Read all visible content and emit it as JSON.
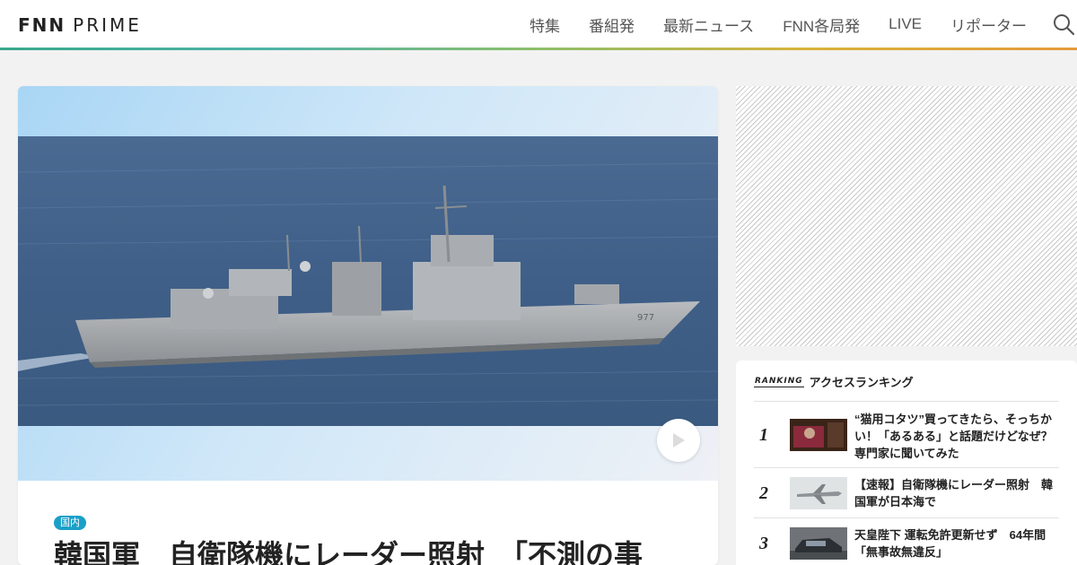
{
  "header": {
    "logo_fnn": "FNN",
    "logo_prime": "PRIME",
    "nav": [
      {
        "label": "特集"
      },
      {
        "label": "番組発"
      },
      {
        "label": "最新ニュース"
      },
      {
        "label": "FNN各局発"
      },
      {
        "label": "LIVE"
      },
      {
        "label": "リポーター"
      }
    ],
    "search_icon": "search-icon",
    "accent_gradient": [
      "#3aa88c",
      "#8cbf6a",
      "#d9b23a",
      "#e59a3c"
    ]
  },
  "hero": {
    "category": "国内",
    "category_color": "#1aa0c8",
    "headline": "韓国軍　自衛隊機にレーダー照射　「不測の事",
    "play_icon": "play-icon"
  },
  "ranking": {
    "badge": "RANKING",
    "title": "アクセスランキング",
    "items": [
      {
        "rank": "1",
        "text": "“猫用コタツ”買ってきたら、そっちかい！「あるある」と話題だけどなぜ？専門家に聞いてみた"
      },
      {
        "rank": "2",
        "text": "【速報】自衛隊機にレーダー照射　韓国軍が日本海で"
      },
      {
        "rank": "3",
        "text": "天皇陛下 運転免許更新せず　64年間「無事故無違反」"
      }
    ]
  }
}
